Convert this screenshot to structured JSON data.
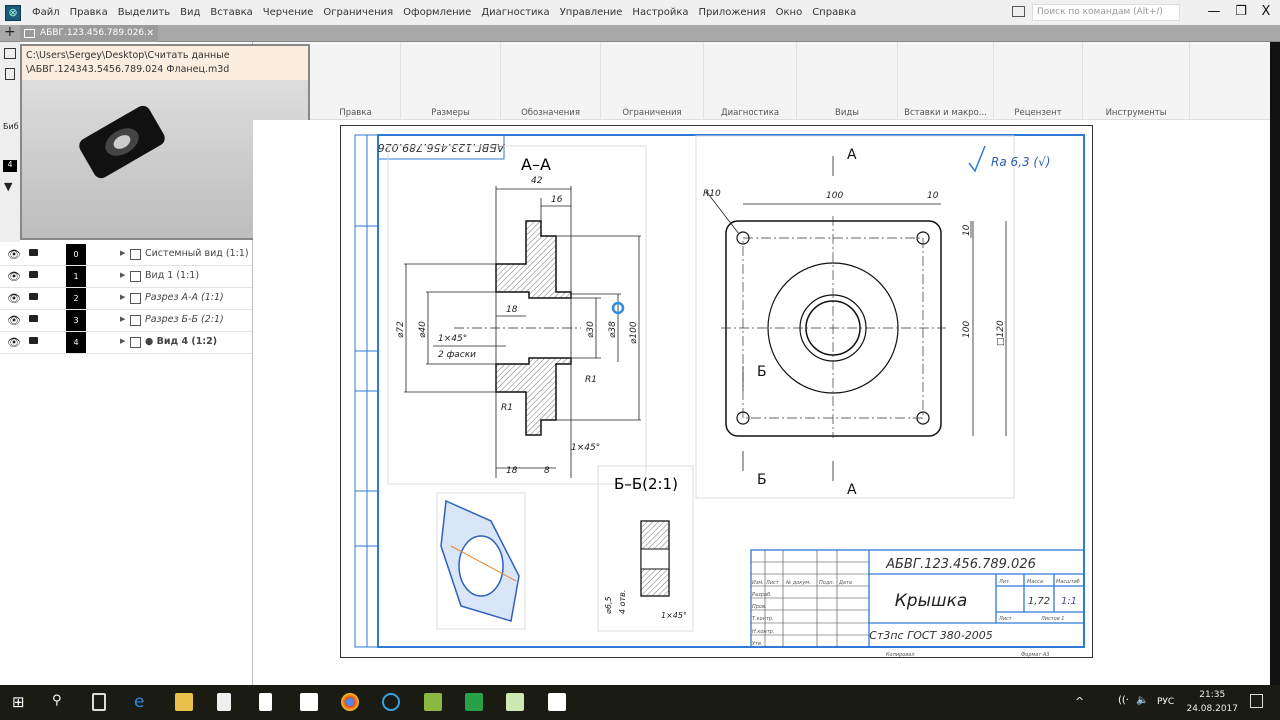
{
  "menu": [
    "Файл",
    "Правка",
    "Выделить",
    "Вид",
    "Вставка",
    "Черчение",
    "Ограничения",
    "Оформление",
    "Диагностика",
    "Управление",
    "Настройка",
    "Приложения",
    "Окно",
    "Справка"
  ],
  "search_placeholder": "Поиск по командам (Alt+/)",
  "window_buttons": {
    "minimize": "—",
    "restore": "❐",
    "close": "X"
  },
  "tab": {
    "label": "АБВГ.123.456.789.026...",
    "close": "×",
    "new": "+"
  },
  "ribbon_groups": [
    "Правка",
    "Размеры",
    "Обозначения",
    "Ограничения",
    "Диагностика",
    "Виды",
    "Вставки и макро...",
    "Рецензент",
    "Инструменты"
  ],
  "preview": {
    "path1": "C:\\Users\\Sergey\\Desktop\\Считать данные",
    "path2": "\\АБВГ.124343.5456.789.024 Фланец.m3d"
  },
  "left_labels": {
    "lib": "Биб",
    "num": "4"
  },
  "tree": [
    {
      "num": "0",
      "label": "Системный вид (1:1)"
    },
    {
      "num": "1",
      "label": "Вид 1 (1:1)"
    },
    {
      "num": "2",
      "label": "Разрез А-А (1:1)"
    },
    {
      "num": "3",
      "label": "Разрез Б-Б (2:1)"
    },
    {
      "num": "4",
      "label": "● Вид 4 (1:2)"
    }
  ],
  "drawing": {
    "code_rotated": "АБВГ.123.456.789.026",
    "section_aa": "А–А",
    "section_bb": "Б–Б(2:1)",
    "dims_aa": {
      "d42": "42",
      "d16": "16",
      "d18a": "18",
      "d18b": "18",
      "d8": "8",
      "d72": "⌀72",
      "d40": "⌀40",
      "d30": "⌀30",
      "d38": "⌀38",
      "d100": "⌀100",
      "ch1": "1×45°",
      "ch1b": "2 фаски",
      "ch2": "1×45°",
      "r1a": "R1",
      "r1b": "R1"
    },
    "dims_front": {
      "r10": "R10",
      "w100": "100",
      "w10": "10",
      "h10": "10",
      "h100": "100",
      "sq": "□120",
      "cutA": "А",
      "cutB": "Б"
    },
    "roughness": "Ra 6,3 (√)",
    "bb": {
      "d65": "⌀6,5",
      "depth": "4 отв.",
      "ch": "1×45°"
    },
    "title_block": {
      "code": "АБВГ.123.456.789.026",
      "name": "Крышка",
      "material": "Ст3пс ГОСТ 380-2005",
      "mass": "1,72",
      "scale": "1:1",
      "lit": "Лит.",
      "mass_h": "Масса",
      "scale_h": "Масштаб",
      "sheet": "Лист",
      "sheets": "Листов 1",
      "rows": [
        "Изм.",
        "Лист",
        "№ докум.",
        "Подп.",
        "Дата",
        "Разраб.",
        "Пров.",
        "Т.контр.",
        "Н.контр.",
        "Утв."
      ],
      "copied": "Копировал",
      "format": "Формат А3"
    }
  },
  "clock": {
    "time": "21:35",
    "date": "24.08.2017",
    "lang": "РУС"
  }
}
